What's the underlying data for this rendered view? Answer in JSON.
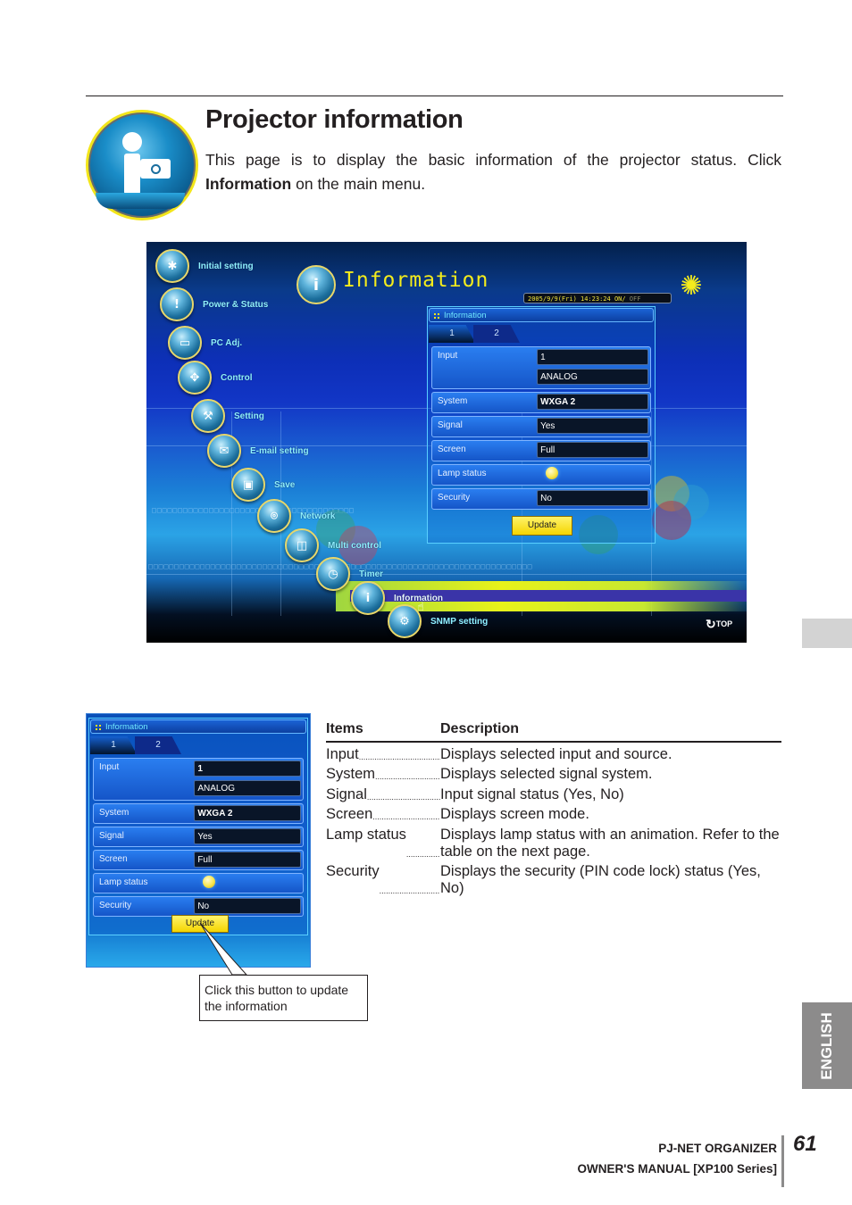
{
  "page": {
    "title": "Projector information",
    "intro_before": "This page is to display the basic information of the projector status. Click ",
    "intro_bold": "Information",
    "intro_after": " on the main menu.",
    "section_icon": "information-projector-icon"
  },
  "screenshot": {
    "menu": [
      {
        "label": "Initial setting",
        "icon": "gear-projector-icon"
      },
      {
        "label": "Power & Status",
        "icon": "power-status-icon"
      },
      {
        "label": "PC Adj.",
        "icon": "monitor-icon"
      },
      {
        "label": "Control",
        "icon": "directional-pad-icon"
      },
      {
        "label": "Setting",
        "icon": "wrench-icon"
      },
      {
        "label": "E-mail setting",
        "icon": "envelope-icon"
      },
      {
        "label": "Save",
        "icon": "floppy-disk-icon"
      },
      {
        "label": "Network",
        "icon": "network-projector-icon"
      },
      {
        "label": "Multi control",
        "icon": "multi-projector-icon"
      },
      {
        "label": "Timer",
        "icon": "clock-icon"
      },
      {
        "label": "Information",
        "icon": "information-icon",
        "selected": true
      },
      {
        "label": "SNMP setting",
        "icon": "snmp-icon"
      }
    ],
    "header_title": "Information",
    "datetime": "2005/9/9(Fri)   14:23:24 ",
    "power_on": "ON/",
    "power_off": " OFF",
    "top_link": "TOP"
  },
  "panel": {
    "title": "Information",
    "tabs": [
      "1",
      "2"
    ],
    "rows": {
      "input_label": "Input",
      "input_value": "1",
      "input_source": "ANALOG",
      "system_label": "System",
      "system_value": "WXGA 2",
      "signal_label": "Signal",
      "signal_value": "Yes",
      "screen_label": "Screen",
      "screen_value": "Full",
      "lamp_label": "Lamp status",
      "security_label": "Security",
      "security_value": "No"
    },
    "update_label": "Update"
  },
  "callout": "Click this button to update the information",
  "table": {
    "headers": [
      "Items",
      "Description"
    ],
    "items": [
      {
        "name": "Input",
        "description": "Displays selected input and source."
      },
      {
        "name": "System",
        "description": "Displays selected signal system."
      },
      {
        "name": "Signal",
        "description": "Input signal status (Yes, No)"
      },
      {
        "name": "Screen",
        "description": "Displays screen mode."
      },
      {
        "name": "Lamp status",
        "description": "Displays lamp status with an animation. Refer to the table on the next page."
      },
      {
        "name": "Security",
        "description": "Displays the security (PIN code lock) status (Yes, No)"
      }
    ]
  },
  "side_tab": "ENGLISH",
  "footer": {
    "line1": "PJ-NET ORGANIZER",
    "line2": "OWNER'S MANUAL [XP100 Series]",
    "page_number": "61"
  }
}
